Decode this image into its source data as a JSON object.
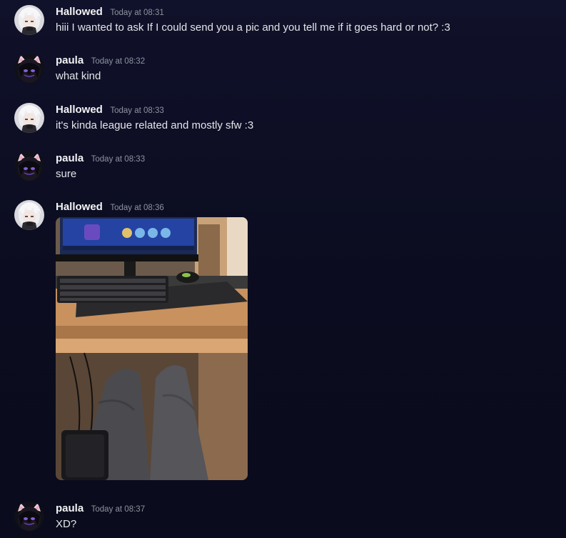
{
  "colors": {
    "background": "#0e0f22",
    "username": "#f2f3f5",
    "timestamp": "#8e92a0",
    "text": "#e3e5e8"
  },
  "messages": [
    {
      "author": "Hallowed",
      "time": "Today at 08:31",
      "text": "hiii I wanted to ask If I could send you a pic and you tell me if it goes hard or not? :3",
      "avatar_icon": "white-haired-anime-avatar-icon"
    },
    {
      "author": "paula",
      "time": "Today at 08:32",
      "text": "what kind",
      "avatar_icon": "dark-cat-ear-anime-avatar-icon"
    },
    {
      "author": "Hallowed",
      "time": "Today at 08:33",
      "text": "it's kinda league related and mostly sfw :3",
      "avatar_icon": "white-haired-anime-avatar-icon"
    },
    {
      "author": "paula",
      "time": "Today at 08:33",
      "text": "sure",
      "avatar_icon": "dark-cat-ear-anime-avatar-icon"
    },
    {
      "author": "Hallowed",
      "time": "Today at 08:36",
      "text": "",
      "avatar_icon": "white-haired-anime-avatar-icon",
      "attachment": "photo-attachment"
    },
    {
      "author": "paula",
      "time": "Today at 08:37",
      "text": "XD?",
      "avatar_icon": "dark-cat-ear-anime-avatar-icon"
    }
  ]
}
